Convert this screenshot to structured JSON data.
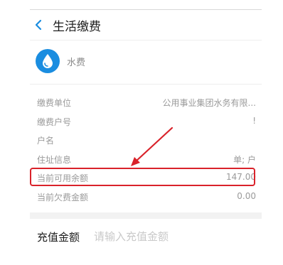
{
  "header": {
    "title": "生活缴费"
  },
  "biller": {
    "name": "水费",
    "icon": "water-drop-icon",
    "icon_color": "#1a8de0"
  },
  "info_rows": [
    {
      "label": "缴费单位",
      "value": "公用事业集团水务有限..."
    },
    {
      "label": "缴费户号",
      "value": "!"
    },
    {
      "label": "户名",
      "value": ""
    },
    {
      "label": "住址信息",
      "value": "单;     户"
    },
    {
      "label": "当前可用余额",
      "value": "147.00"
    },
    {
      "label": "当前欠费金额",
      "value": "0.00"
    }
  ],
  "recharge": {
    "label": "充值金额",
    "placeholder": "请输入充值金额"
  },
  "colors": {
    "accent": "#1a8de0",
    "highlight": "#d9222a"
  }
}
